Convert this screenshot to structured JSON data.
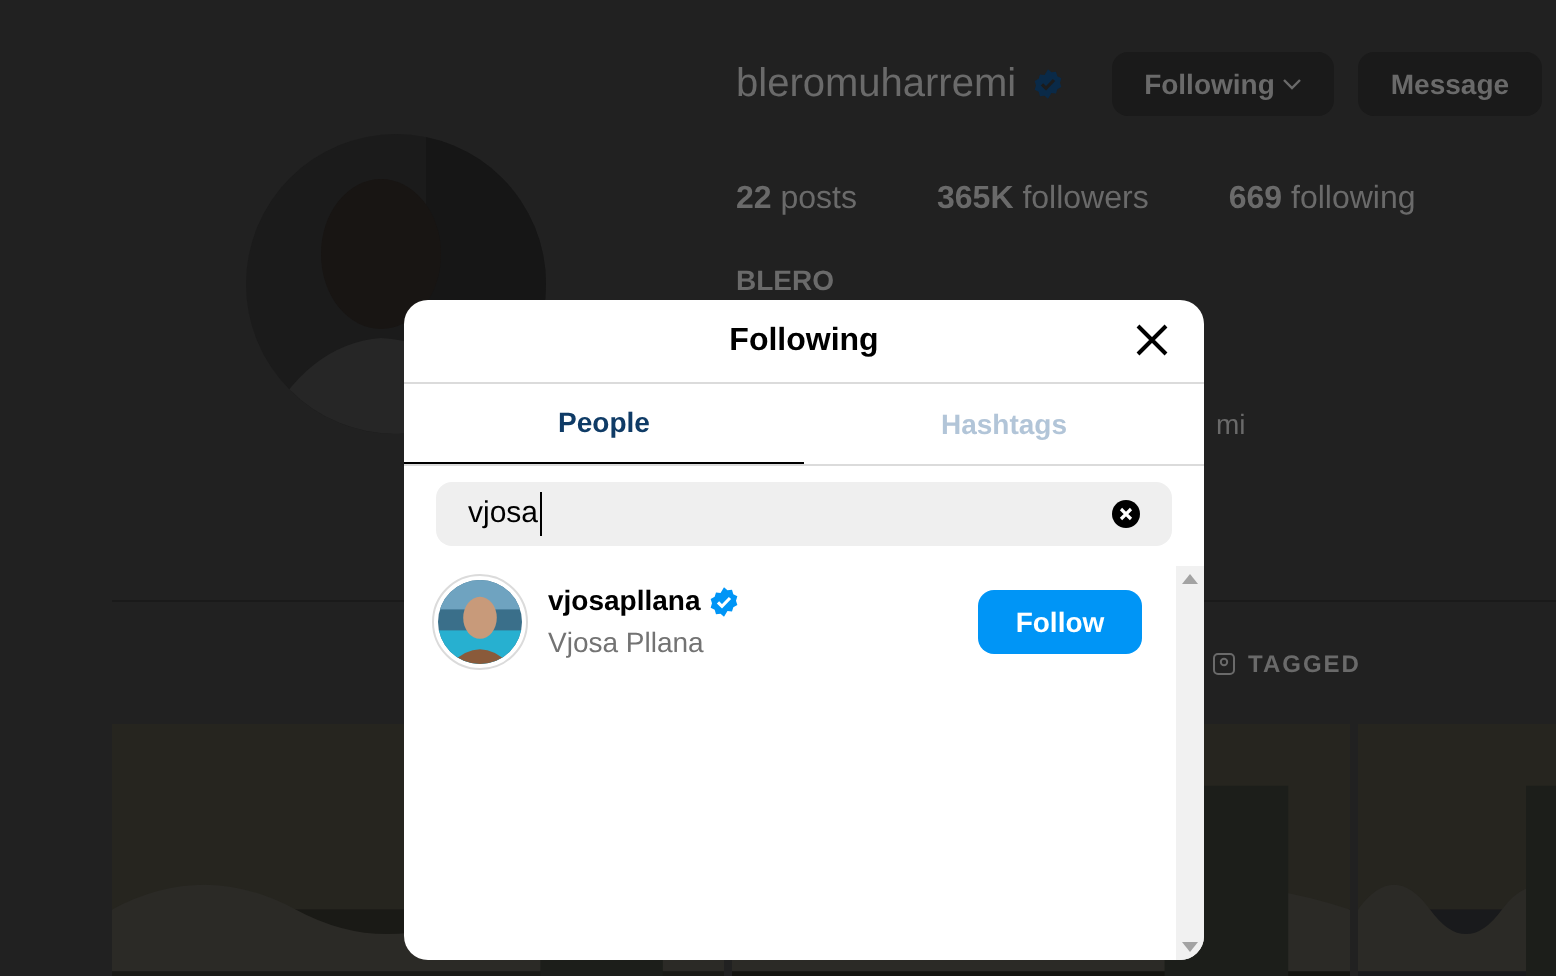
{
  "profile": {
    "username": "bleromuharremi",
    "verified": true,
    "buttons": [
      {
        "label": "Following",
        "kind": "dropdown"
      },
      {
        "label": "Message",
        "kind": "plain"
      }
    ],
    "stats": [
      {
        "count": "22",
        "label": "posts"
      },
      {
        "count": "365K",
        "label": "followers"
      },
      {
        "count": "669",
        "label": "following"
      }
    ],
    "name": "BLERO",
    "bio_fragment": "mi"
  },
  "profile_tabs": [
    {
      "label": "TAGGED",
      "selected": false
    }
  ],
  "modal": {
    "title": "Following",
    "tabs": [
      {
        "label": "People",
        "selected": true
      },
      {
        "label": "Hashtags",
        "selected": false
      }
    ],
    "search": {
      "value": "vjosa"
    },
    "results": [
      {
        "username": "vjosapllana",
        "verified": true,
        "full_name": "Vjosa Pllana",
        "button": "Follow"
      }
    ]
  }
}
